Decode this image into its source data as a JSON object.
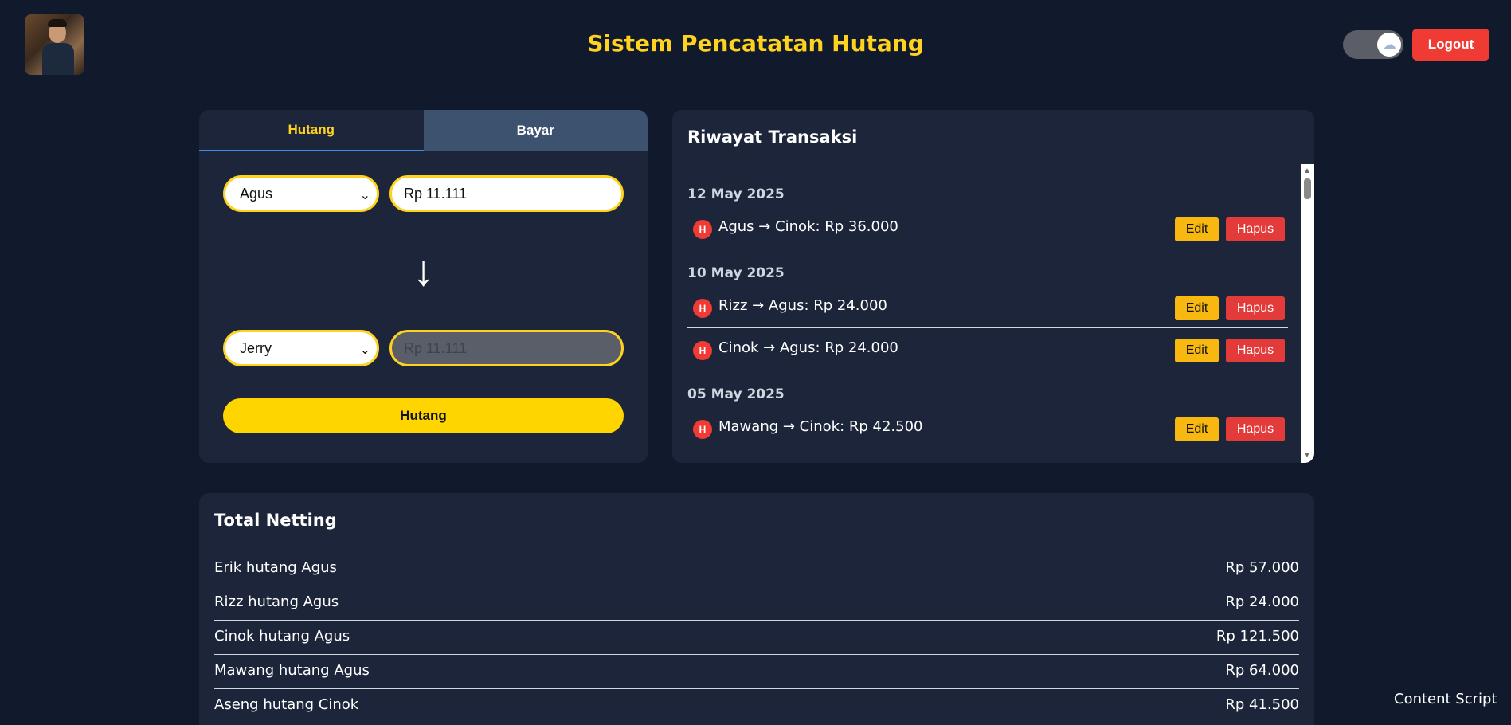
{
  "header": {
    "title": "Sistem Pencatatan Hutang",
    "toggle_icon": "☁",
    "logout_label": "Logout"
  },
  "form": {
    "tabs": [
      {
        "label": "Hutang",
        "active": true
      },
      {
        "label": "Bayar",
        "active": false
      }
    ],
    "from_person": "Agus",
    "from_amount": "Rp 11.111",
    "arrow": "↓",
    "to_person": "Jerry",
    "to_amount": "Rp 11.111",
    "submit_label": "Hutang"
  },
  "history": {
    "title": "Riwayat Transaksi",
    "edit_label": "Edit",
    "delete_label": "Hapus",
    "badge": "H",
    "groups": [
      {
        "date": "12 May 2025",
        "items": [
          {
            "text": "Agus → Cinok: Rp 36.000"
          }
        ]
      },
      {
        "date": "10 May 2025",
        "items": [
          {
            "text": "Rizz → Agus: Rp 24.000"
          },
          {
            "text": "Cinok → Agus: Rp 24.000"
          }
        ]
      },
      {
        "date": "05 May 2025",
        "items": [
          {
            "text": "Mawang → Cinok: Rp 42.500"
          }
        ]
      }
    ]
  },
  "netting": {
    "title": "Total Netting",
    "rows": [
      {
        "name": "Erik hutang Agus",
        "amount": "Rp 57.000"
      },
      {
        "name": "Rizz hutang Agus",
        "amount": "Rp 24.000"
      },
      {
        "name": "Cinok hutang Agus",
        "amount": "Rp 121.500"
      },
      {
        "name": "Mawang hutang Agus",
        "amount": "Rp 64.000"
      },
      {
        "name": "Aseng hutang Cinok",
        "amount": "Rp 41.500"
      }
    ]
  },
  "footer": {
    "content_script": "Content Script"
  },
  "colors": {
    "background": "#111a2c",
    "card": "#1c2539",
    "accent_yellow": "#ffd21f",
    "danger_red": "#ef3b34"
  }
}
